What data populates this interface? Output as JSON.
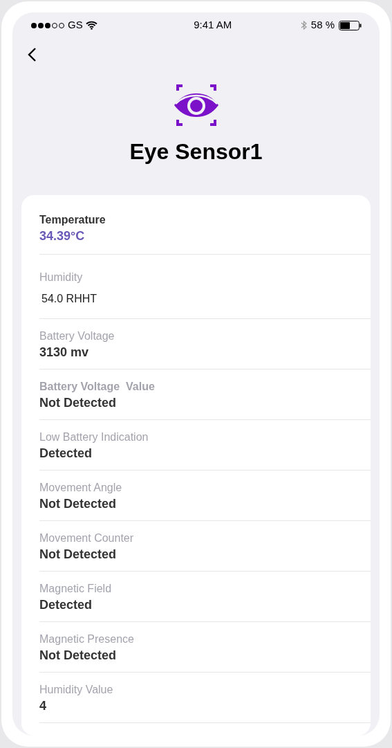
{
  "status_bar": {
    "carrier": "GS",
    "time": "9:41 AM",
    "battery": "58 %"
  },
  "title": "Eye Sensor1",
  "readings": [
    {
      "kind": "accent",
      "label": "Temperature",
      "value": "34.39°C"
    },
    {
      "kind": "small",
      "label": "Humidity",
      "value": "54.0 RHHT"
    },
    {
      "kind": "normal",
      "label": "Battery Voltage",
      "value": "3130 mv"
    },
    {
      "kind": "strong",
      "label": "Battery Voltage  Value",
      "value": "Not Detected"
    },
    {
      "kind": "normal",
      "label": "Low Battery Indication",
      "value": "Detected"
    },
    {
      "kind": "normal",
      "label": "Movement Angle",
      "value": "Not Detected"
    },
    {
      "kind": "normal",
      "label": "Movement Counter",
      "value": "Not Detected"
    },
    {
      "kind": "normal",
      "label": "Magnetic Field",
      "value": "Detected"
    },
    {
      "kind": "normal",
      "label": "Magnetic Presence",
      "value": "Not Detected"
    },
    {
      "kind": "normal",
      "label": "Humidity Value",
      "value": "4"
    }
  ]
}
